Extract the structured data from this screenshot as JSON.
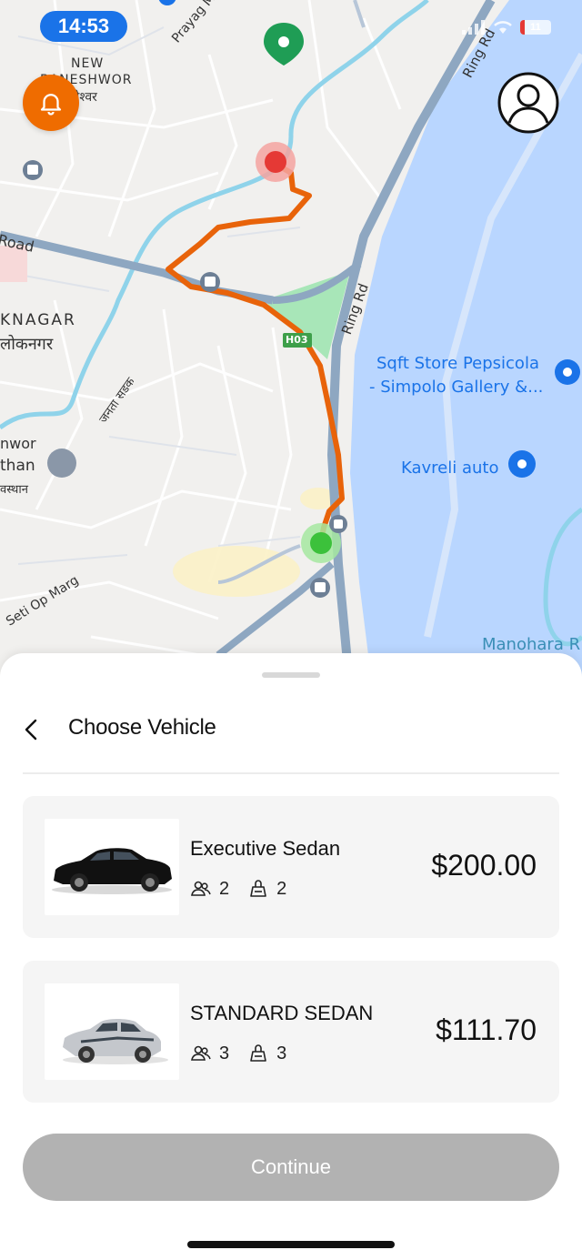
{
  "status_bar": {
    "time": "14:53",
    "battery": "11"
  },
  "map": {
    "labels": {
      "new_baneshwor_1": "NEW",
      "new_baneshwor_2": "BANESHWOR",
      "new_baneshwor_np": "बानेश्वर",
      "prayag_marg": "Prayag Marg",
      "ring_rd_1": "Ring Rd",
      "ring_rd_2": "Ring Rd",
      "road": "Road",
      "lokanagar": "KNAGAR",
      "lokanagar_np": "लोकनगर",
      "highway": "H03",
      "janata_sadak": "जनता सडक",
      "sqft_store_1": "Sqft Store Pepsicola",
      "sqft_store_2": "- Simpolo Gallery &...",
      "kavreli_auto": "Kavreli auto",
      "nwor": "nwor",
      "than": "than",
      "than_np": "वस्थान",
      "seti_op_marg": "Seti Op Marg",
      "manohara": "Manohara R"
    }
  },
  "sheet": {
    "title": "Choose Vehicle",
    "vehicles": [
      {
        "name": "Executive Sedan",
        "passengers": "2",
        "luggage": "2",
        "price": "$200.00"
      },
      {
        "name": "STANDARD SEDAN",
        "passengers": "3",
        "luggage": "3",
        "price": "$111.70"
      }
    ],
    "continue_label": "Continue"
  },
  "colors": {
    "route": "#e8630a",
    "accent": "#1a73e8",
    "bell": "#ef6c00",
    "river": "#b9d6ff",
    "disabled": "#b2b2b2"
  }
}
